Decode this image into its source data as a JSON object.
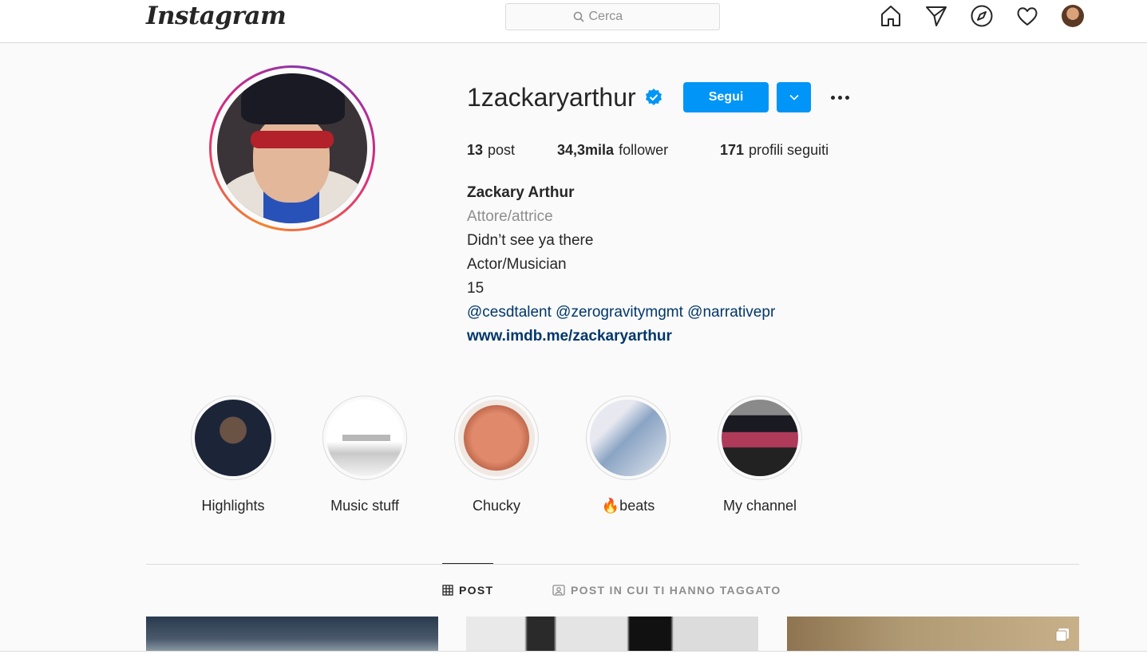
{
  "header": {
    "logo_text": "Instagram",
    "search_placeholder": "Cerca",
    "nav_icons": [
      "home-icon",
      "direct-icon",
      "explore-icon",
      "activity-heart-icon",
      "profile-avatar"
    ]
  },
  "profile": {
    "username": "1zackaryarthur",
    "verified": true,
    "follow_label": "Segui",
    "stats": {
      "posts_count": "13",
      "posts_label": "post",
      "followers_count": "34,3mila",
      "followers_label": "follower",
      "following_count": "171",
      "following_label": "profili seguiti"
    },
    "bio": {
      "full_name": "Zackary Arthur",
      "category": "Attore/attrice",
      "line1": "Didn’t see ya there",
      "line2": "Actor/Musician",
      "line3": "15",
      "mentions": "@cesdtalent @zerogravitymgmt @narrativepr",
      "website": "www.imdb.me/zackaryarthur"
    }
  },
  "highlights": [
    {
      "label": "Highlights"
    },
    {
      "label": "Music stuff"
    },
    {
      "label": "Chucky"
    },
    {
      "label": "🔥beats"
    },
    {
      "label": "My channel"
    }
  ],
  "tabs": {
    "posts": "POST",
    "tagged": "POST IN CUI TI HANNO TAGGATO"
  },
  "colors": {
    "accent": "#0095f6",
    "link": "#00376b",
    "muted": "#8e8e8e",
    "text": "#262626",
    "border": "#dbdbdb"
  }
}
